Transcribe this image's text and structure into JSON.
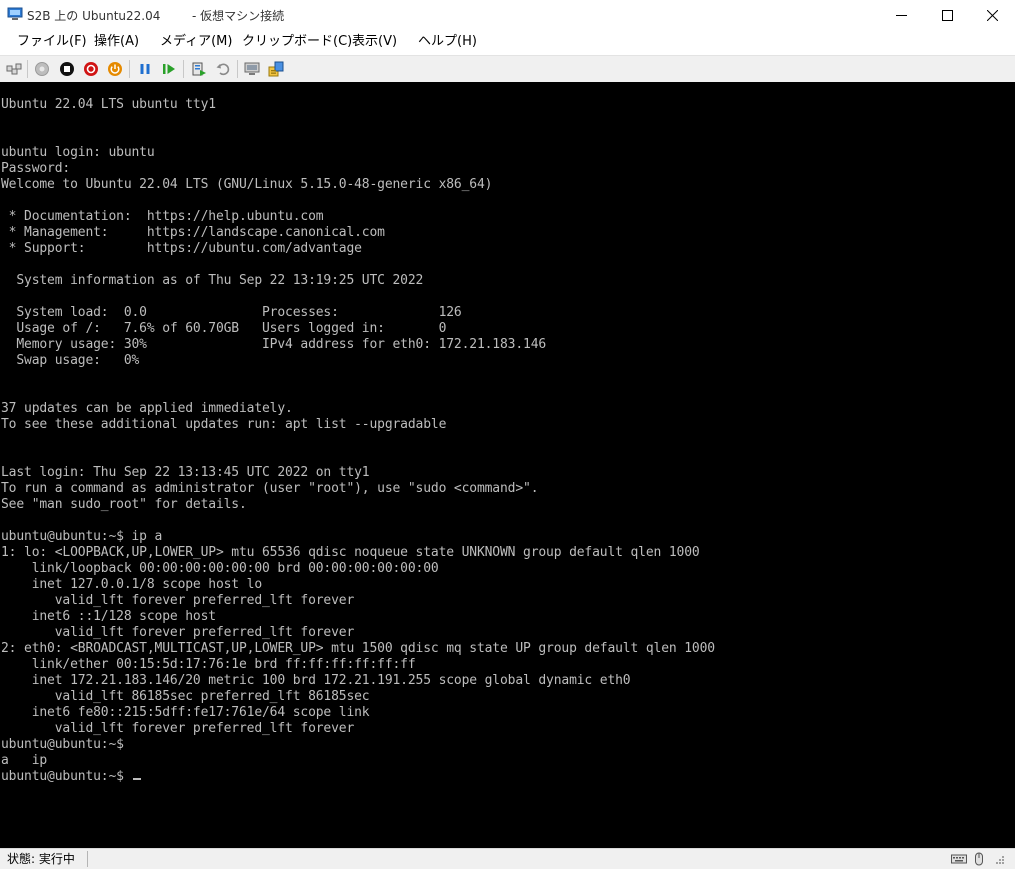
{
  "window": {
    "title_host": "S2B 上の Ubuntu22.04",
    "title_suffix": "- 仮想マシン接続"
  },
  "menubar": {
    "items": [
      {
        "label": "ファイル(F)"
      },
      {
        "label": "操作(A)"
      },
      {
        "label": "メディア(M)"
      },
      {
        "label": "クリップボード(C)"
      },
      {
        "label": "表示(V)"
      },
      {
        "label": "ヘルプ(H)"
      }
    ]
  },
  "toolbar": {
    "icons": [
      "ctrl-alt-del-icon",
      "start-icon",
      "turn-off-icon",
      "shut-down-icon",
      "power-icon",
      "pause-icon",
      "resume-icon",
      "checkpoint-icon",
      "revert-icon",
      "enhanced-session-icon",
      "share-icon"
    ]
  },
  "terminal": {
    "lines": [
      "Ubuntu 22.04 LTS ubuntu tty1",
      "",
      "",
      "ubuntu login: ubuntu",
      "Password:",
      "Welcome to Ubuntu 22.04 LTS (GNU/Linux 5.15.0-48-generic x86_64)",
      "",
      " * Documentation:  https://help.ubuntu.com",
      " * Management:     https://landscape.canonical.com",
      " * Support:        https://ubuntu.com/advantage",
      "",
      "  System information as of Thu Sep 22 13:19:25 UTC 2022",
      "",
      "  System load:  0.0               Processes:             126",
      "  Usage of /:   7.6% of 60.70GB   Users logged in:       0",
      "  Memory usage: 30%               IPv4 address for eth0: 172.21.183.146",
      "  Swap usage:   0%",
      "",
      "",
      "37 updates can be applied immediately.",
      "To see these additional updates run: apt list --upgradable",
      "",
      "",
      "Last login: Thu Sep 22 13:13:45 UTC 2022 on tty1",
      "To run a command as administrator (user \"root\"), use \"sudo <command>\".",
      "See \"man sudo_root\" for details.",
      "",
      "ubuntu@ubuntu:~$ ip a",
      "1: lo: <LOOPBACK,UP,LOWER_UP> mtu 65536 qdisc noqueue state UNKNOWN group default qlen 1000",
      "    link/loopback 00:00:00:00:00:00 brd 00:00:00:00:00:00",
      "    inet 127.0.0.1/8 scope host lo",
      "       valid_lft forever preferred_lft forever",
      "    inet6 ::1/128 scope host",
      "       valid_lft forever preferred_lft forever",
      "2: eth0: <BROADCAST,MULTICAST,UP,LOWER_UP> mtu 1500 qdisc mq state UP group default qlen 1000",
      "    link/ether 00:15:5d:17:76:1e brd ff:ff:ff:ff:ff:ff",
      "    inet 172.21.183.146/20 metric 100 brd 172.21.191.255 scope global dynamic eth0",
      "       valid_lft 86185sec preferred_lft 86185sec",
      "    inet6 fe80::215:5dff:fe17:761e/64 scope link",
      "       valid_lft forever preferred_lft forever",
      "ubuntu@ubuntu:~$",
      "a   ip"
    ],
    "prompt": "ubuntu@ubuntu:~$ "
  },
  "statusbar": {
    "status": "状態: 実行中"
  },
  "colors": {
    "console_bg": "#000000",
    "console_fg": "#bdbdbd"
  }
}
